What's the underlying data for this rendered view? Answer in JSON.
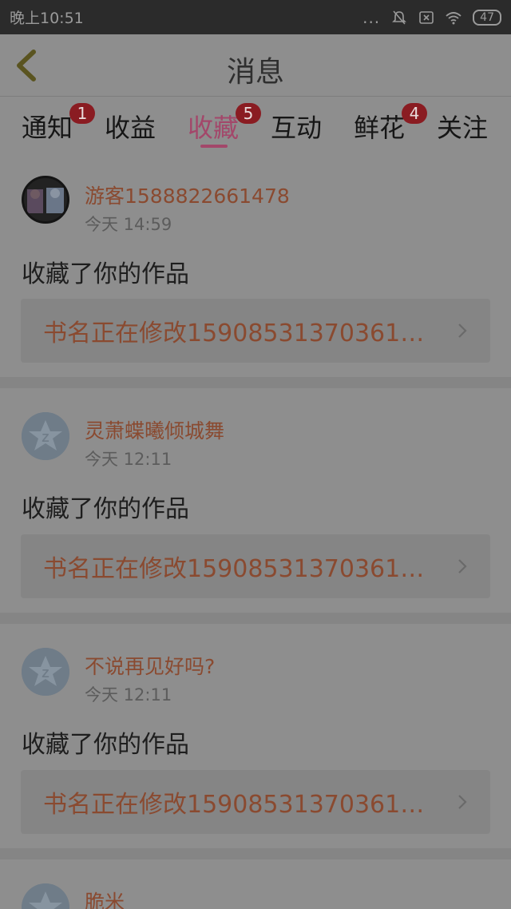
{
  "status_bar": {
    "time": "晚上10:51",
    "dots": "...",
    "battery": "47"
  },
  "header": {
    "title": "消息"
  },
  "tabs": [
    {
      "label": "通知",
      "badge": "1"
    },
    {
      "label": "收益",
      "badge": ""
    },
    {
      "label": "收藏",
      "badge": "5"
    },
    {
      "label": "互动",
      "badge": ""
    },
    {
      "label": "鲜花",
      "badge": "4"
    },
    {
      "label": "关注",
      "badge": ""
    }
  ],
  "active_tab": "收藏",
  "messages": [
    {
      "username": "游客1588822661478",
      "time": "今天 14:59",
      "action": "收藏了你的作品",
      "work_title": "书名正在修改15908531370361…",
      "avatar": "photo-avatar"
    },
    {
      "username": "灵萧蝶曦倾城舞",
      "time": "今天 12:11",
      "action": "收藏了你的作品",
      "work_title": "书名正在修改15908531370361…",
      "avatar": "default-avatar-icon"
    },
    {
      "username": "不说再见好吗?",
      "time": "今天 12:11",
      "action": "收藏了你的作品",
      "work_title": "书名正在修改15908531370361…",
      "avatar": "default-avatar-icon"
    },
    {
      "username": "脆米",
      "avatar": "default-avatar-icon"
    }
  ],
  "colors": {
    "accent": "#a3476a",
    "username": "#8a4a30",
    "badge": "#8a1c22",
    "overlay_bg": "#8e8e8e"
  }
}
